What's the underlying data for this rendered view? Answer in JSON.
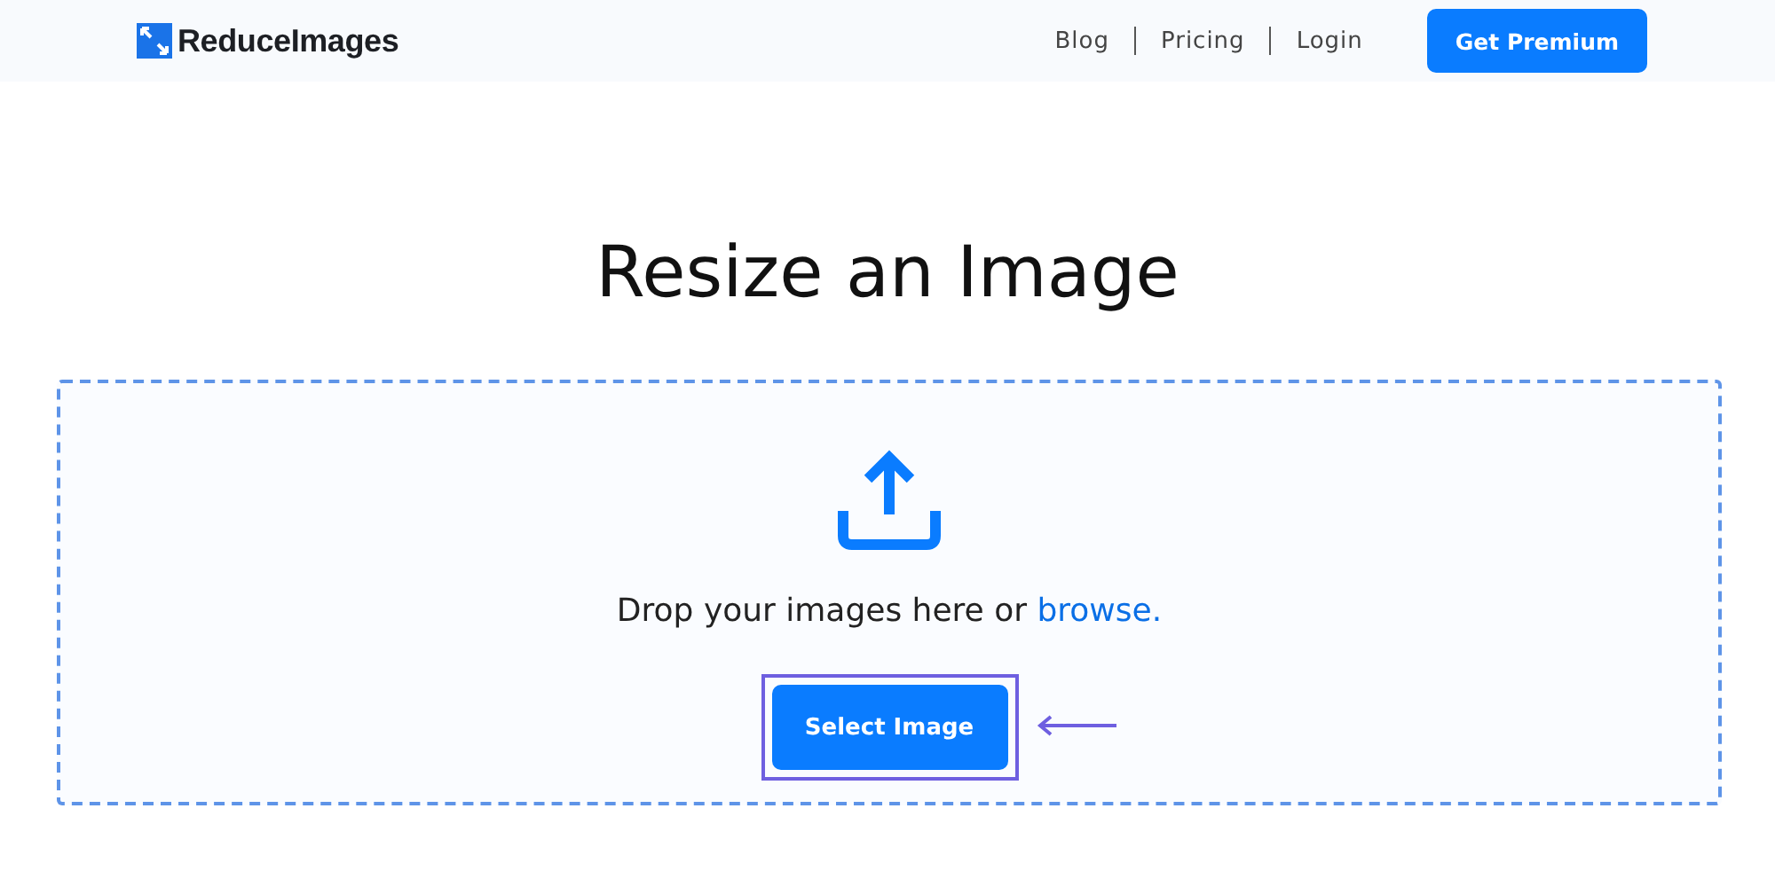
{
  "header": {
    "logo": "ReduceImages",
    "nav": [
      {
        "label": "Blog"
      },
      {
        "label": "Pricing"
      },
      {
        "label": "Login"
      }
    ],
    "cta": "Get Premium"
  },
  "title": "Resize an Image",
  "dropzone": {
    "prompt": "Drop your images here or ",
    "link": "browse.",
    "button": "Select Image",
    "highlighted": true
  }
}
